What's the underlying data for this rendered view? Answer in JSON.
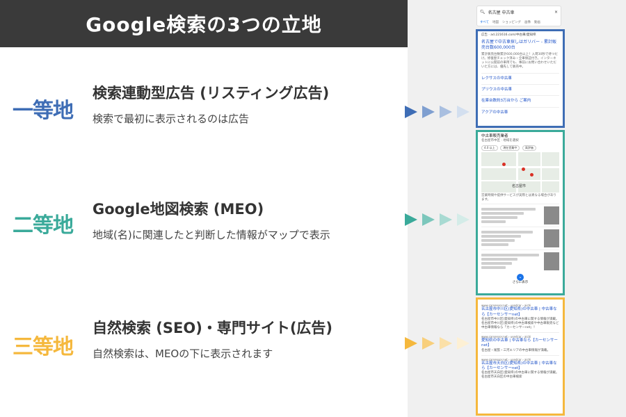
{
  "header": {
    "title": "Google検索の3つの立地"
  },
  "colors": {
    "tier1": "#3e6db5",
    "tier2": "#3aaa9a",
    "tier3": "#f5b83d",
    "banner": "#3a3a3a"
  },
  "tiers": [
    {
      "label": "一等地",
      "title": "検索連動型広告 (リスティング広告)",
      "desc": "検索で最初に表示されるのは広告"
    },
    {
      "label": "二等地",
      "title": "Google地図検索 (MEO)",
      "desc": "地域(名)に関連したと判断した情報がマップで表示"
    },
    {
      "label": "三等地",
      "title": "自然検索 (SEO)・専門サイト(広告)",
      "desc": "自然検索は、MEOの下に表示されます"
    }
  ],
  "mock": {
    "search_query": "名古屋 中古車",
    "tabs": [
      "すべて",
      "地図",
      "ショッピング",
      "画像",
      "動画"
    ],
    "ad": {
      "sponsor": "広告 · ad.221616.com/中古車/愛知県",
      "title": "名古屋で中古車探しはガリバー - 累計販売台数600,000台",
      "desc": "累計販売台数累計600,000台以上！入荷30秒で待つだけ。修復歴チェック済み・全車保証付き。インターネットに公開前の車両でも、事前にお問い合わせいただいた方には、優先して販売中。",
      "sitelinks": [
        "レクサスの中古車",
        "プリウスの中古車",
        "在庫台数約3万台から ご案内",
        "アクアの中古車"
      ]
    },
    "local": {
      "heading": "中古車販売業者",
      "subheading": "名古屋市中区 · 地域を選択",
      "chips": [
        "4.0 以上",
        "現在営業中",
        "高評価"
      ],
      "map_label": "名古屋市",
      "notice": "営業時間や提供サービスが実際とは異なる場合があります。",
      "more": "さらに表示"
    },
    "organic": [
      {
        "site": "www.carsensor.net › usedcar › aichi",
        "title": "名古屋市中川区(愛知県)の中古車 | 中古車なら【カーセンサーnet】",
        "desc": "名古屋市中川区(愛知県)の中古車に関する情報が満載。名古屋市中川区(愛知県)の中古車検索や中古車販売など中古車情報なら「カーセンサーnet」！"
      },
      {
        "site": "www.carsensor.net › usedcar › aichi",
        "title": "愛知県の中古車 | 中古車なら【カーセンサーnet】",
        "desc": "名古屋・尾張・三河エリアの中古車情報が満載。"
      },
      {
        "site": "www.carsensor.net › usedcar › aichi",
        "title": "名古屋市天白区(愛知県)の中古車 | 中古車なら【カーセンサーnet】",
        "desc": "名古屋市天白区(愛知県)の中古車に関する情報が満載。名古屋市天白区の中古車検索"
      }
    ]
  }
}
